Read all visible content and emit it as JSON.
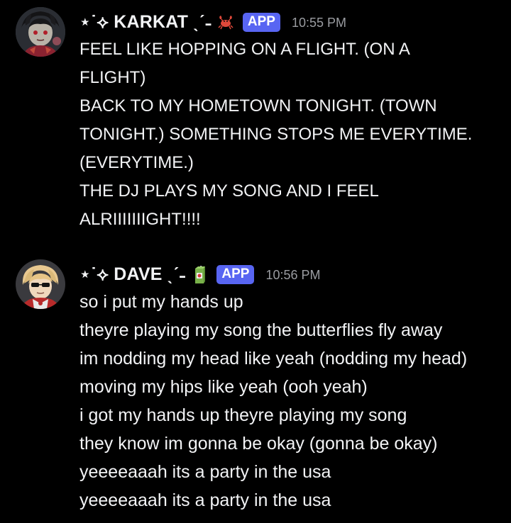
{
  "messages": [
    {
      "username": "⋆˙⟡ KARKAT ˎˊ˗",
      "name_emoji_icon": "crab-icon",
      "badge": "APP",
      "time": "10:55 PM",
      "avatar_icon": "karkat-avatar",
      "lines": [
        "FEEL LIKE HOPPING ON A FLIGHT. (ON A",
        "FLIGHT)",
        "BACK TO MY HOMETOWN TONIGHT. (TOWN",
        "TONIGHT.) SOMETHING STOPS ME EVERYTIME.",
        "(EVERYTIME.)",
        "THE DJ PLAYS MY SONG AND I FEEL",
        "ALRIIIIIIIGHT!!!!"
      ]
    },
    {
      "username": "⋆˙⟡ DAVE ˎˊ˗",
      "name_emoji_icon": "juice-box-icon",
      "badge": "APP",
      "time": "10:56 PM",
      "avatar_icon": "dave-avatar",
      "lines": [
        "so i put my hands up",
        "theyre playing my song the butterflies fly away",
        "im nodding my head like yeah (nodding my head)",
        "moving my hips like yeah (ooh yeah)",
        "i got my hands up theyre playing my song",
        "they know im gonna be okay (gonna be okay)",
        "yeeeeaaah its a party in the usa",
        "yeeeeaaah its a party in the usa"
      ]
    }
  ],
  "colors": {
    "background": "#000000",
    "text": "#f2f3f5",
    "timestamp": "#9a9ca1",
    "app_badge": "#5865f2"
  }
}
